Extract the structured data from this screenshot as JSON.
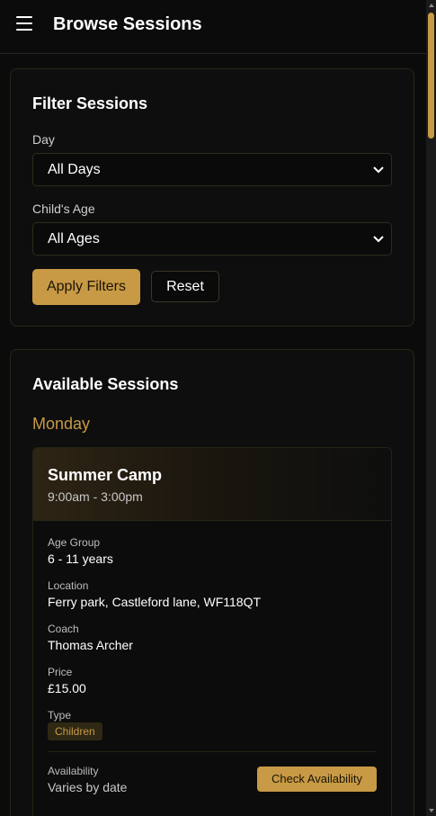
{
  "header": {
    "title": "Browse Sessions"
  },
  "filter": {
    "title": "Filter Sessions",
    "day_label": "Day",
    "day_value": "All Days",
    "age_label": "Child's Age",
    "age_value": "All Ages",
    "apply_label": "Apply Filters",
    "reset_label": "Reset"
  },
  "sessions": {
    "title": "Available Sessions",
    "days": [
      {
        "name": "Monday",
        "items": [
          {
            "title": "Summer Camp",
            "time": "9:00am - 3:00pm",
            "age_group_label": "Age Group",
            "age_group": "6 - 11 years",
            "location_label": "Location",
            "location": "Ferry park, Castleford lane, WF118QT",
            "coach_label": "Coach",
            "coach": "Thomas Archer",
            "price_label": "Price",
            "price": "£15.00",
            "type_label": "Type",
            "type": "Children",
            "availability_label": "Availability",
            "availability": "Varies by date",
            "check_label": "Check Availability"
          }
        ]
      }
    ]
  },
  "colors": {
    "accent": "#c89a45",
    "background": "#0b0b0b",
    "card": "#0e0e0e"
  },
  "icons": {
    "menu": "hamburger-menu-icon",
    "select": "chevron-down-icon"
  }
}
